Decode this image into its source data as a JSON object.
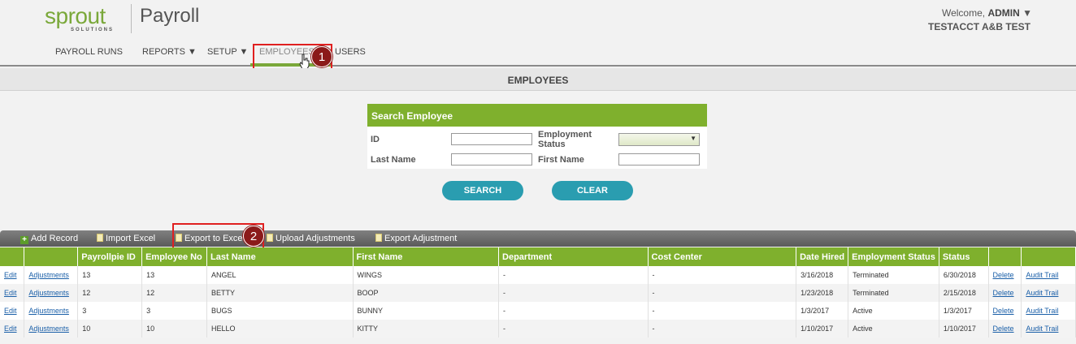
{
  "brand": {
    "logo_word": "sprout",
    "logo_sub": "SOLUTIONS",
    "product": "Payroll"
  },
  "user": {
    "welcome": "Welcome,",
    "name": "ADMIN",
    "company": "TESTACCT A&B TEST"
  },
  "nav": {
    "items": [
      {
        "label": "PAYROLL RUNS"
      },
      {
        "label": "REPORTS ▼"
      },
      {
        "label": "SETUP ▼"
      },
      {
        "label": "EMPLOYEES"
      },
      {
        "label": "USERS"
      }
    ]
  },
  "callouts": [
    "1",
    "2"
  ],
  "page_title": "EMPLOYEES",
  "search": {
    "title": "Search Employee",
    "id_label": "ID",
    "id_value": "",
    "status_label": "Employment Status",
    "status_value": "",
    "last_name_label": "Last Name",
    "last_name_value": "",
    "first_name_label": "First Name",
    "first_name_value": "",
    "search_button": "SEARCH",
    "clear_button": "CLEAR"
  },
  "toolbar": {
    "add_record": "Add Record",
    "import_excel": "Import Excel",
    "export_excel": "Export to Excel",
    "upload_adjustments": "Upload Adjustments",
    "export_adjustment": "Export Adjustment"
  },
  "table": {
    "columns": [
      "",
      "",
      "Payrollpie ID",
      "Employee No",
      "Last Name",
      "First Name",
      "Department",
      "Cost Center",
      "Date Hired",
      "Employment Status",
      "Status",
      "",
      ""
    ],
    "rows": [
      {
        "edit": "Edit",
        "adjustments": "Adjustments",
        "payrollpie_id": "13",
        "employee_no": "13",
        "last_name": "ANGEL",
        "first_name": "WINGS",
        "department": "-",
        "cost_center": "-",
        "date_hired": "3/16/2018",
        "employment_status": "Terminated",
        "status": "6/30/2018",
        "delete": "Delete",
        "audit_trail": "Audit Trail"
      },
      {
        "edit": "Edit",
        "adjustments": "Adjustments",
        "payrollpie_id": "12",
        "employee_no": "12",
        "last_name": "BETTY",
        "first_name": "BOOP",
        "department": "-",
        "cost_center": "-",
        "date_hired": "1/23/2018",
        "employment_status": "Terminated",
        "status": "2/15/2018",
        "delete": "Delete",
        "audit_trail": "Audit Trail"
      },
      {
        "edit": "Edit",
        "adjustments": "Adjustments",
        "payrollpie_id": "3",
        "employee_no": "3",
        "last_name": "BUGS",
        "first_name": "BUNNY",
        "department": "-",
        "cost_center": "-",
        "date_hired": "1/3/2017",
        "employment_status": "Active",
        "status": "1/3/2017",
        "delete": "Delete",
        "audit_trail": "Audit Trail"
      },
      {
        "edit": "Edit",
        "adjustments": "Adjustments",
        "payrollpie_id": "10",
        "employee_no": "10",
        "last_name": "HELLO",
        "first_name": "KITTY",
        "department": "-",
        "cost_center": "-",
        "date_hired": "1/10/2017",
        "employment_status": "Active",
        "status": "1/10/2017",
        "delete": "Delete",
        "audit_trail": "Audit Trail"
      }
    ]
  },
  "colors": {
    "accent_green": "#7fb02d",
    "button_teal": "#2a9db0",
    "callout_red": "#e02020",
    "badge": "#8b1a1a",
    "link": "#1a5fa8"
  }
}
